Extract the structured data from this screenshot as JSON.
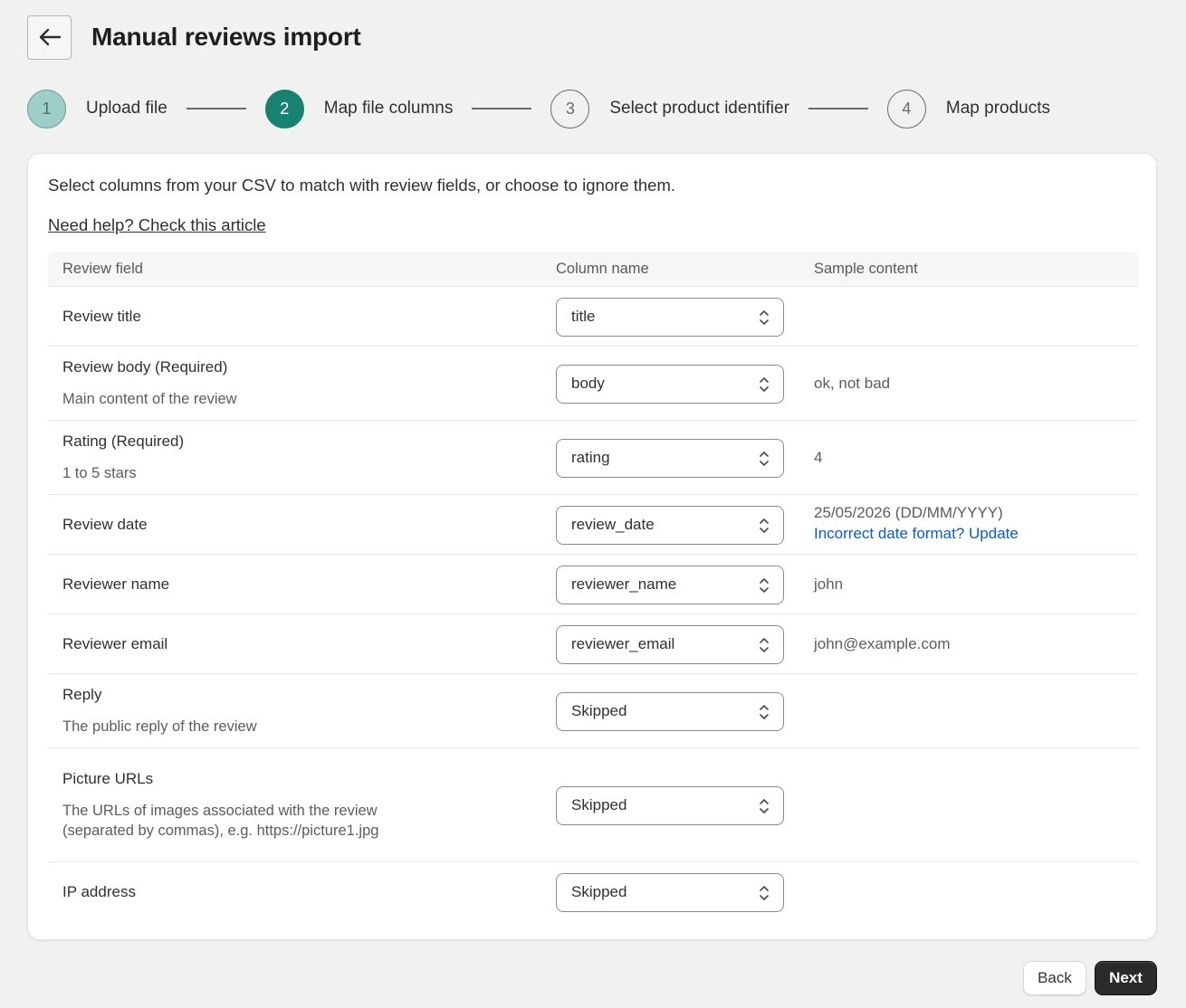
{
  "header": {
    "title": "Manual reviews import",
    "back_icon": "arrow-left-icon"
  },
  "stepper": {
    "steps": [
      {
        "number": "1",
        "label": "Upload file",
        "state": "done"
      },
      {
        "number": "2",
        "label": "Map file columns",
        "state": "active"
      },
      {
        "number": "3",
        "label": "Select product identifier",
        "state": "pending"
      },
      {
        "number": "4",
        "label": "Map products",
        "state": "pending"
      }
    ]
  },
  "card": {
    "intro": "Select columns from your CSV to match with review fields, or choose to ignore them.",
    "help_link": "Need help? Check this article"
  },
  "table": {
    "headers": {
      "field": "Review field",
      "column": "Column name",
      "sample": "Sample content"
    },
    "rows": [
      {
        "title": "Review title",
        "desc": "",
        "column": "title",
        "sample": "",
        "sample_link": ""
      },
      {
        "title": "Review body (Required)",
        "desc": "Main content of the review",
        "column": "body",
        "sample": "ok, not bad",
        "sample_link": ""
      },
      {
        "title": "Rating (Required)",
        "desc": "1 to 5 stars",
        "column": "rating",
        "sample": "4",
        "sample_link": ""
      },
      {
        "title": "Review date",
        "desc": "",
        "column": "review_date",
        "sample": "25/05/2026 (DD/MM/YYYY)",
        "sample_link": "Incorrect date format? Update"
      },
      {
        "title": "Reviewer name",
        "desc": "",
        "column": "reviewer_name",
        "sample": "john",
        "sample_link": ""
      },
      {
        "title": "Reviewer email",
        "desc": "",
        "column": "reviewer_email",
        "sample": "john@example.com",
        "sample_link": ""
      },
      {
        "title": "Reply",
        "desc": "The public reply of the review",
        "column": "Skipped",
        "sample": "",
        "sample_link": ""
      },
      {
        "title": "Picture URLs",
        "desc": "The URLs of images associated with the review (separated by commas), e.g. https://picture1.jpg",
        "column": "Skipped",
        "sample": "",
        "sample_link": ""
      },
      {
        "title": "IP address",
        "desc": "",
        "column": "Skipped",
        "sample": "",
        "sample_link": ""
      }
    ]
  },
  "footer": {
    "back_label": "Back",
    "next_label": "Next"
  },
  "colors": {
    "accent": "#17826f",
    "done_step": "#9fcdc7",
    "link": "#0b5cc7",
    "primary_button": "#2b2b2b"
  }
}
